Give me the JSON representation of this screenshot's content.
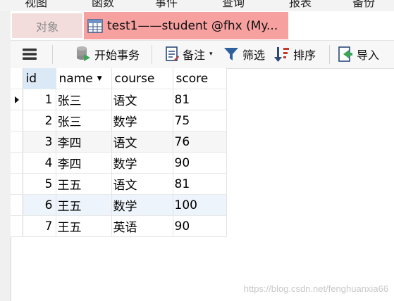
{
  "menu": [
    "视图",
    "函数",
    "事件",
    "查询",
    "报表",
    "备份"
  ],
  "tabs": {
    "objects_label": "对象",
    "active_label": "test1——student @fhx (My..."
  },
  "toolbar": {
    "begin_transaction": "开始事务",
    "memo": "备注",
    "filter": "筛选",
    "sort": "排序",
    "import": "导入"
  },
  "table": {
    "columns": [
      "id",
      "name",
      "course",
      "score"
    ],
    "rows": [
      {
        "id": "1",
        "name": "张三",
        "course": "语文",
        "score": "81"
      },
      {
        "id": "2",
        "name": "张三",
        "course": "数学",
        "score": "75"
      },
      {
        "id": "3",
        "name": "李四",
        "course": "语文",
        "score": "76"
      },
      {
        "id": "4",
        "name": "李四",
        "course": "数学",
        "score": "90"
      },
      {
        "id": "5",
        "name": "王五",
        "course": "语文",
        "score": "81"
      },
      {
        "id": "6",
        "name": "王五",
        "course": "数学",
        "score": "100"
      },
      {
        "id": "7",
        "name": "王五",
        "course": "英语",
        "score": "90"
      }
    ]
  },
  "watermark": "https://blog.csdn.net/fenghuanxia66"
}
